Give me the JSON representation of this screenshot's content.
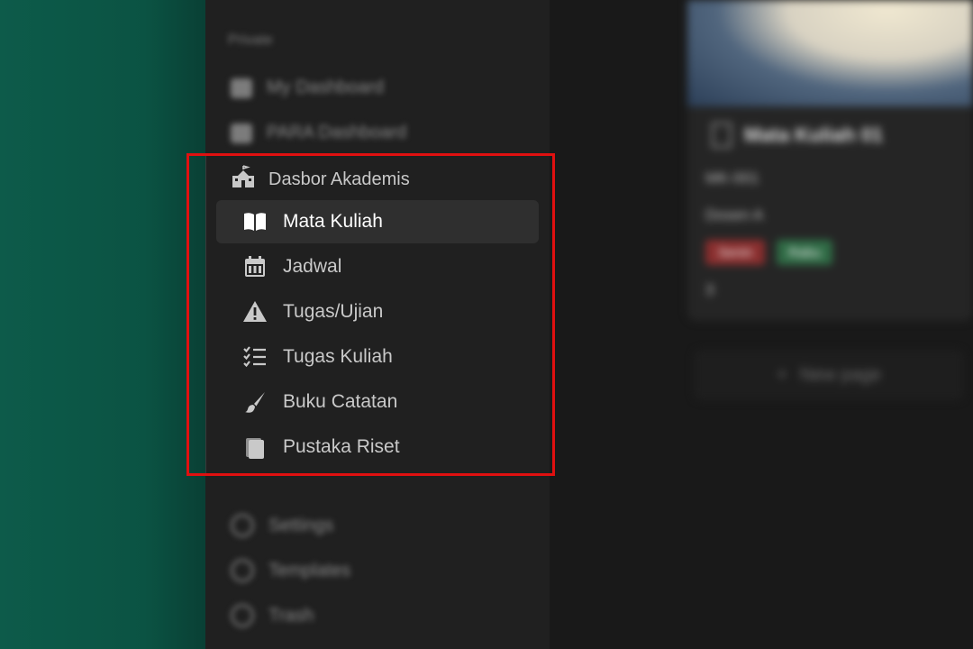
{
  "sidebar": {
    "private_label": "Private",
    "top_items": [
      {
        "label": "My Dashboard",
        "icon": "dashboard-icon"
      },
      {
        "label": "PARA Dashboard",
        "icon": "grid-icon"
      }
    ],
    "section": {
      "title": "Dasbor Akademis",
      "icon": "school-icon",
      "items": [
        {
          "label": "Mata Kuliah",
          "icon": "open-book-icon",
          "active": true
        },
        {
          "label": "Jadwal",
          "icon": "calendar-icon",
          "active": false
        },
        {
          "label": "Tugas/Ujian",
          "icon": "warning-icon",
          "active": false
        },
        {
          "label": "Tugas Kuliah",
          "icon": "checklist-icon",
          "active": false
        },
        {
          "label": "Buku Catatan",
          "icon": "brush-icon",
          "active": false
        },
        {
          "label": "Pustaka Riset",
          "icon": "books-icon",
          "active": false
        }
      ]
    },
    "bottom_items": [
      {
        "label": "Settings",
        "icon": "gear-icon"
      },
      {
        "label": "Templates",
        "icon": "template-icon"
      },
      {
        "label": "Trash",
        "icon": "trash-icon"
      }
    ]
  },
  "card": {
    "title": "Mata Kuliah 01",
    "code": "MK-001",
    "lecturer": "Dosen A",
    "tags": [
      {
        "label": "Senin",
        "color": "#8a2e2e"
      },
      {
        "label": "Rabu",
        "color": "#2f6b45"
      }
    ],
    "credits": "3"
  },
  "new_page": {
    "label": "New page"
  },
  "colors": {
    "highlight": "#e01010",
    "active_bg": "#2f2f2f",
    "sidebar_bg": "#202020"
  }
}
